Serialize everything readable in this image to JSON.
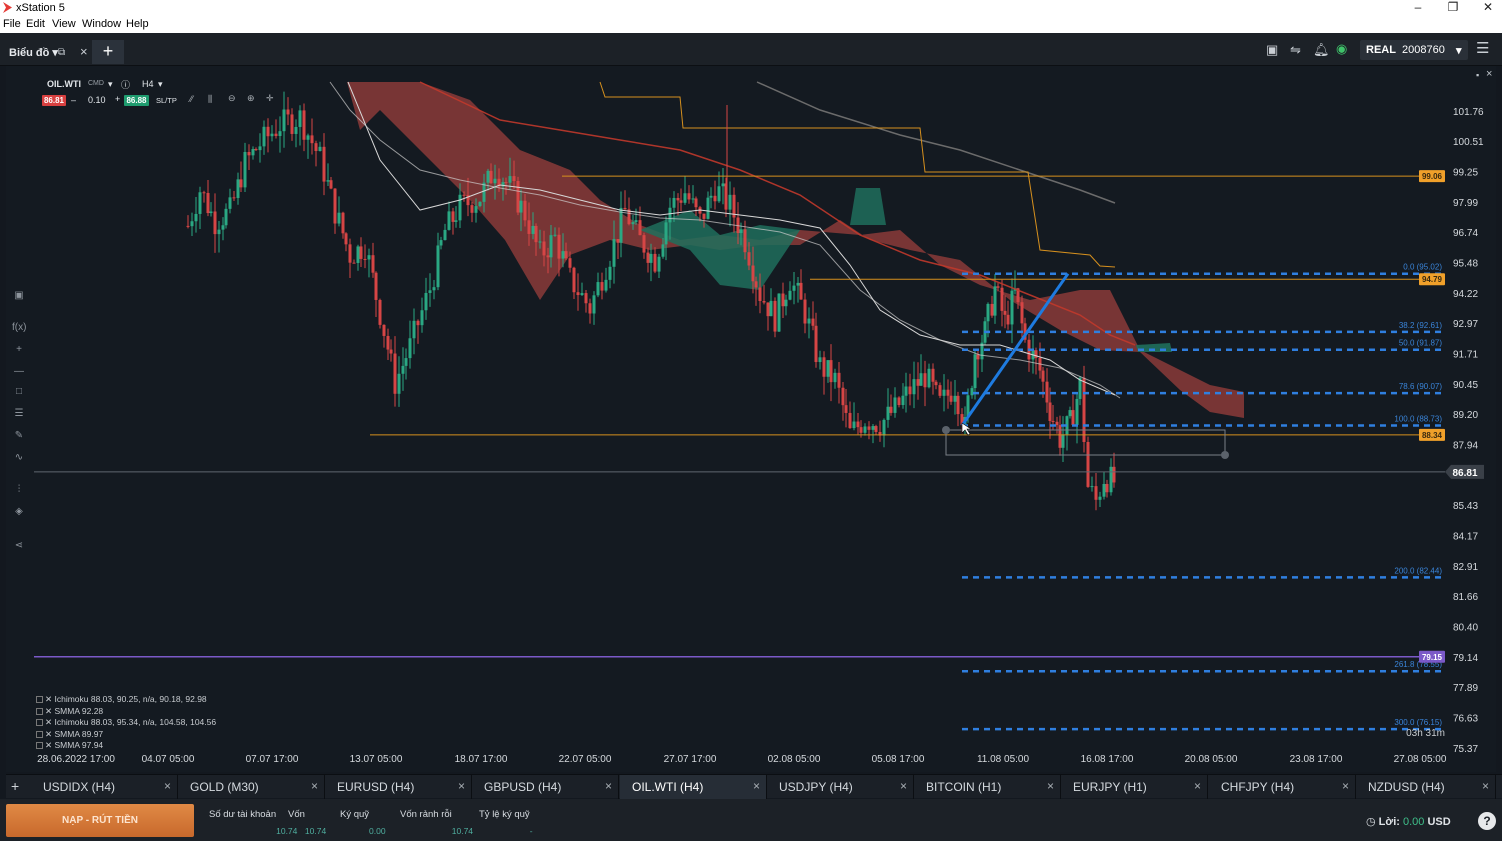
{
  "window": {
    "title": "xStation 5",
    "menu": [
      "File",
      "Edit",
      "View",
      "Window",
      "Help"
    ]
  },
  "toolbar": {
    "tab_label": "Biểu đồ",
    "account_type": "REAL",
    "account_number": "2008760"
  },
  "symbol": {
    "name": "OIL.WTI",
    "instrument_type": "CMD",
    "timeframe": "H4",
    "bid": "86.81",
    "spread": "0.10",
    "ask": "86.88",
    "sltp": "SL/TP"
  },
  "price_axis": [
    "101.76",
    "100.51",
    "99.25",
    "97.99",
    "96.74",
    "95.48",
    "94.22",
    "92.97",
    "91.71",
    "90.45",
    "89.20",
    "87.94",
    "86.81",
    "85.43",
    "84.17",
    "82.91",
    "81.66",
    "80.40",
    "79.14",
    "77.89",
    "76.63",
    "75.37"
  ],
  "time_axis": [
    "28.06.2022 17:00",
    "04.07 05:00",
    "07.07 17:00",
    "13.07 05:00",
    "18.07 17:00",
    "22.07 05:00",
    "27.07 17:00",
    "02.08 05:00",
    "05.08 17:00",
    "11.08 05:00",
    "16.08 17:00",
    "20.08 05:00",
    "23.08 17:00",
    "27.08 05:00"
  ],
  "level_tags": {
    "l1": "99.06",
    "l2": "94.79",
    "l3": "88.34",
    "current": "86.81",
    "l4": "79.15"
  },
  "fibonacci": [
    {
      "label": "0.0 (95.02)"
    },
    {
      "label": "38.2 (92.61)"
    },
    {
      "label": "50.0 (91.87)"
    },
    {
      "label": "78.6 (90.07)"
    },
    {
      "label": "100.0 (88.73)"
    },
    {
      "label": "200.0 (82.44)"
    },
    {
      "label": "261.8 (78.55)"
    },
    {
      "label": "300.0 (76.15)"
    }
  ],
  "countdown": "03h 31m",
  "indicators": [
    "Ichimoku 88.03, 90.25, n/a, 90.18, 92.98",
    "SMMA 92.28",
    "Ichimoku 88.03, 95.34, n/a, 104.58, 104.56",
    "SMMA 89.97",
    "SMMA 97.94"
  ],
  "tabs": [
    "USDIDX (H4)",
    "GOLD (M30)",
    "EURUSD (H4)",
    "GBPUSD (H4)",
    "OIL.WTI (H4)",
    "USDJPY (H4)",
    "BITCOIN (H1)",
    "EURJPY (H1)",
    "CHFJPY (H4)",
    "NZDUSD (H4)"
  ],
  "footer": {
    "deposit_button": "NẠP - RÚT TIỀN",
    "stats": [
      {
        "label": "Số dư tài khoản",
        "value": "10.74"
      },
      {
        "label": "Vốn",
        "value": "10.74"
      },
      {
        "label": "Ký quỹ",
        "value": "0.00"
      },
      {
        "label": "Vốn rảnh rỗi",
        "value": "10.74"
      },
      {
        "label": "Tỷ lệ ký quỹ",
        "value": "-"
      }
    ],
    "profit_label": "Lời:",
    "profit_value": "0.00",
    "currency": "USD",
    "help": "?"
  },
  "colors": {
    "bull": "#2aa883",
    "bear": "#d64545",
    "fib": "#2f7fe0",
    "level": "#d6901e",
    "purple": "#7b59c8",
    "cloud_bear": "#8a3b38",
    "cloud_bull": "#1f6f5c",
    "deposit": "#d97a3a"
  }
}
